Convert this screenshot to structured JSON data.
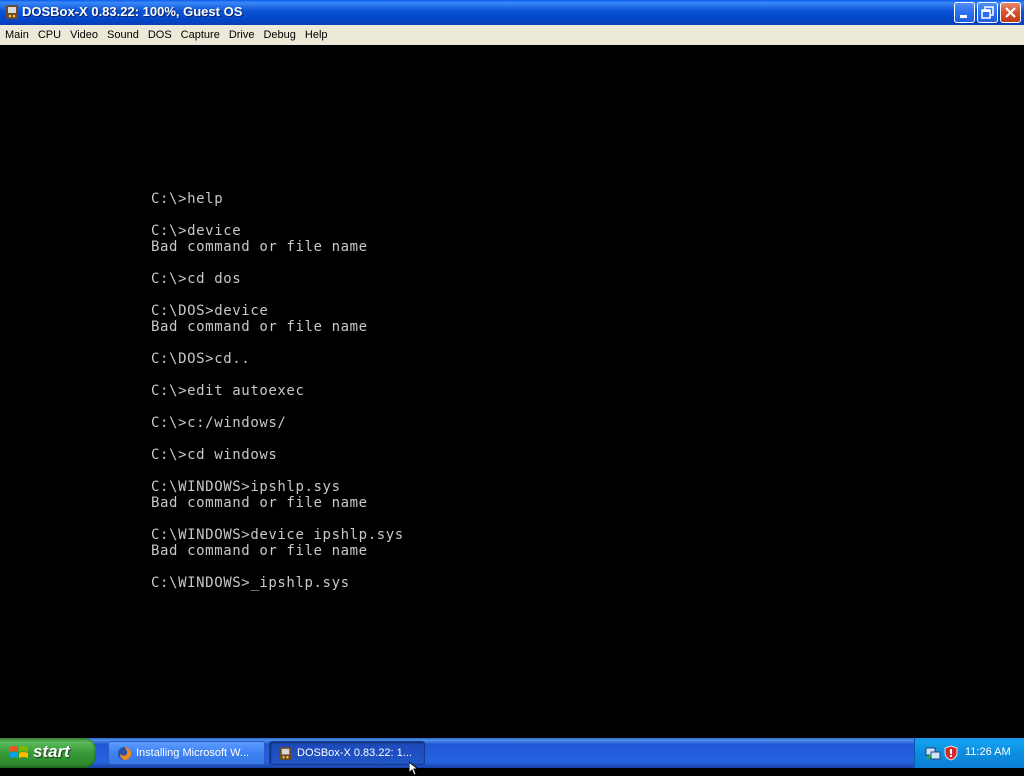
{
  "window": {
    "title": "DOSBox-X 0.83.22: 100%, Guest OS"
  },
  "menubar": {
    "items": [
      "Main",
      "CPU",
      "Video",
      "Sound",
      "DOS",
      "Capture",
      "Drive",
      "Debug",
      "Help"
    ]
  },
  "dos_screen": {
    "lines": [
      "C:\\>help",
      "",
      "C:\\>device",
      "Bad command or file name",
      "",
      "C:\\>cd dos",
      "",
      "C:\\DOS>device",
      "Bad command or file name",
      "",
      "C:\\DOS>cd..",
      "",
      "C:\\>edit autoexec",
      "",
      "C:\\>c:/windows/",
      "",
      "C:\\>cd windows",
      "",
      "C:\\WINDOWS>ipshlp.sys",
      "Bad command or file name",
      "",
      "C:\\WINDOWS>device ipshlp.sys",
      "Bad command or file name",
      "",
      "C:\\WINDOWS>_ipshlp.sys"
    ],
    "text_color": "#c8c8c8"
  },
  "taskbar": {
    "start_label": "start",
    "tasks": [
      {
        "label": "Installing Microsoft W...",
        "icon": "firefox-icon"
      },
      {
        "label": "DOSBox-X 0.83.22: 1...",
        "icon": "dosbox-icon"
      }
    ],
    "clock": "11:26 AM"
  },
  "colors": {
    "titlebar": "#0a52d6",
    "menubar": "#ece9d8",
    "taskbar": "#2663e0",
    "start_button": "#379a37",
    "tray": "#0c8ee0"
  }
}
